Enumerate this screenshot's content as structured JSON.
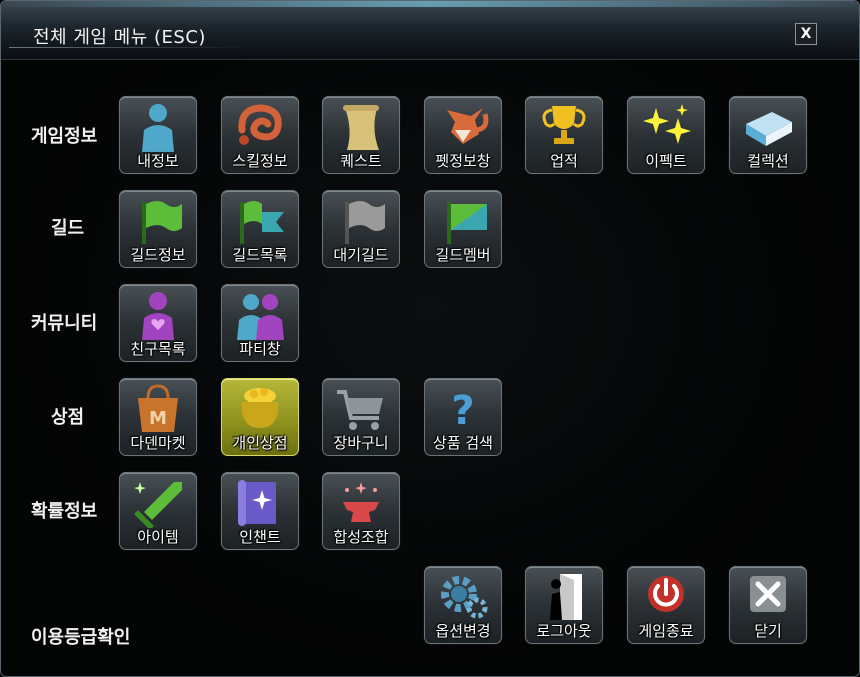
{
  "window": {
    "title": "전체 게임 메뉴 (ESC)",
    "close_label": "X"
  },
  "categories": [
    {
      "label": "게임정보",
      "buttons": [
        {
          "label": "내정보",
          "icon": "person-icon"
        },
        {
          "label": "스킬정보",
          "icon": "skill-swirl-icon"
        },
        {
          "label": "퀘스트",
          "icon": "scroll-icon"
        },
        {
          "label": "펫정보창",
          "icon": "fox-icon"
        },
        {
          "label": "업적",
          "icon": "trophy-icon"
        },
        {
          "label": "이펙트",
          "icon": "sparkle-icon"
        },
        {
          "label": "컬렉션",
          "icon": "book-icon"
        }
      ]
    },
    {
      "label": "길드",
      "buttons": [
        {
          "label": "길드정보",
          "icon": "green-flag-icon"
        },
        {
          "label": "길드목록",
          "icon": "flags-icon"
        },
        {
          "label": "대기길드",
          "icon": "gray-flag-icon"
        },
        {
          "label": "길드멤버",
          "icon": "split-flag-icon"
        }
      ]
    },
    {
      "label": "커뮤니티",
      "buttons": [
        {
          "label": "친구목록",
          "icon": "friend-icon"
        },
        {
          "label": "파티창",
          "icon": "party-icon"
        }
      ]
    },
    {
      "label": "상점",
      "buttons": [
        {
          "label": "다덴마켓",
          "icon": "shopping-bag-icon"
        },
        {
          "label": "개인상점",
          "icon": "gold-pot-icon",
          "active": true
        },
        {
          "label": "장바구니",
          "icon": "cart-icon"
        },
        {
          "label": "상품 검색",
          "icon": "question-icon"
        }
      ]
    },
    {
      "label": "확률정보",
      "buttons": [
        {
          "label": "아이템",
          "icon": "sword-icon"
        },
        {
          "label": "인챈트",
          "icon": "enchant-scroll-icon"
        },
        {
          "label": "합성조합",
          "icon": "anvil-icon"
        }
      ]
    }
  ],
  "footer": {
    "rating_label": "이용등급확인",
    "buttons": [
      {
        "label": "옵션변경",
        "icon": "gear-icon"
      },
      {
        "label": "로그아웃",
        "icon": "door-icon"
      },
      {
        "label": "게임종료",
        "icon": "power-icon"
      },
      {
        "label": "닫기",
        "icon": "close-icon"
      }
    ]
  },
  "colors": {
    "active_button": "#9a9d22",
    "text": "#ffffff"
  }
}
